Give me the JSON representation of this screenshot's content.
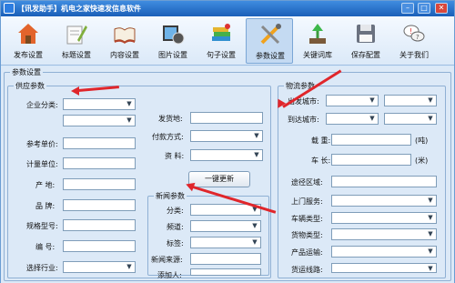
{
  "window": {
    "title": "【讯发助手】机电之家快速发信息软件",
    "min": "–",
    "max": "□",
    "close": "✕"
  },
  "toolbar": [
    {
      "label": "发布设置",
      "icon": "house-icon"
    },
    {
      "label": "标题设置",
      "icon": "pencil-notepad-icon"
    },
    {
      "label": "内容设置",
      "icon": "open-book-icon"
    },
    {
      "label": "图片设置",
      "icon": "picture-icon"
    },
    {
      "label": "句子设置",
      "icon": "books-icon"
    },
    {
      "label": "参数设置",
      "icon": "tools-icon",
      "active": true
    },
    {
      "label": "关键词库",
      "icon": "plant-arrow-icon"
    },
    {
      "label": "保存配置",
      "icon": "floppy-disk-icon"
    },
    {
      "label": "关于我们",
      "icon": "chat-bubbles-icon"
    }
  ],
  "params": {
    "legend": "参数设置"
  },
  "supply": {
    "legend": "供应参数",
    "category": "企业分类:",
    "price_unit": "参考单价:",
    "measure_unit": "计量单位:",
    "origin": "产 地:",
    "brand": "品 牌:",
    "model": "规格型号:",
    "code": "编 号:",
    "industry": "选择行业:",
    "ship_from": "发货地:",
    "payment": "付款方式:",
    "material": "资 料:",
    "update_button": "一键更新"
  },
  "news": {
    "legend": "新闻参数",
    "category": "分类:",
    "channel": "频道:",
    "tag": "标签:",
    "source": "新闻来源:",
    "author": "添加人:"
  },
  "logistics": {
    "legend": "物流参数",
    "from_city": "出发城市:",
    "to_city": "到达城市:",
    "weight": "载 重:",
    "weight_unit": "(吨)",
    "length": "车 长:",
    "length_unit": "(米)",
    "route_area": "途径区域:",
    "door_service": "上门服务:",
    "vehicle_type": "车辆类型:",
    "cargo_type": "货物类型:",
    "product_transport": "产品运输:",
    "route": "货运线路:"
  },
  "colors": {
    "accent": "#1a5fb8",
    "annotation_arrow": "#e0262b"
  }
}
